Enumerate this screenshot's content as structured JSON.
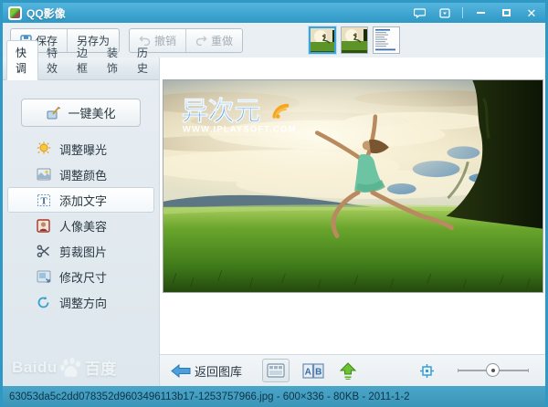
{
  "window": {
    "title": "QQ影像"
  },
  "toolbar": {
    "save_label": "保存",
    "save_as_label": "另存为",
    "undo_label": "撤销",
    "redo_label": "重做"
  },
  "tabs": [
    {
      "label": "快调",
      "active": true
    },
    {
      "label": "特效",
      "active": false
    },
    {
      "label": "边框",
      "active": false
    },
    {
      "label": "装饰",
      "active": false
    },
    {
      "label": "历史",
      "active": false
    }
  ],
  "sidebar": {
    "primary_button_label": "一键美化",
    "items": [
      {
        "label": "调整曝光",
        "icon": "exposure-bulb-icon"
      },
      {
        "label": "调整颜色",
        "icon": "color-adjust-icon"
      },
      {
        "label": "添加文字",
        "icon": "add-text-icon",
        "hovered": true
      },
      {
        "label": "人像美容",
        "icon": "portrait-beauty-icon"
      },
      {
        "label": "剪裁图片",
        "icon": "crop-scissors-icon"
      },
      {
        "label": "修改尺寸",
        "icon": "resize-icon"
      },
      {
        "label": "调整方向",
        "icon": "rotate-icon"
      }
    ]
  },
  "photo": {
    "watermark_title": "异次元",
    "watermark_url": "WWW.IPLAYSOFT.COM"
  },
  "bottom_bar": {
    "back_label": "返回图库",
    "compare_label": "AB"
  },
  "status_bar": {
    "text": "63053da5c2dd078352d9603496113b17-1253757966.jpg - 600×336 - 80KB - 2011-1-2"
  },
  "overlay_watermark": {
    "brand": "Baidu",
    "brand_cn": "百度"
  },
  "colors": {
    "titlebar": "#3aa4d2",
    "statusbar": "#3f9dc0",
    "accent_blue": "#3a9fd0",
    "selection_border": "#3fa3d8",
    "upload_green": "#57b52c",
    "watermark_orange": "#f5a623"
  }
}
